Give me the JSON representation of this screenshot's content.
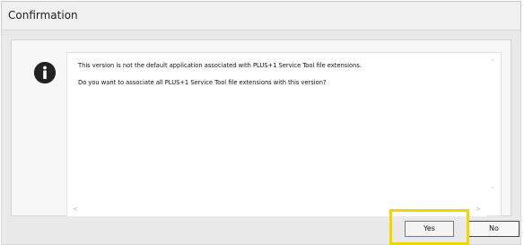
{
  "window": {
    "title": "Confirmation"
  },
  "message": {
    "line1": "This version is not the default application associated with PLUS+1 Service Tool file extensions.",
    "line2": "Do you want to associate all PLUS+1 Service Tool file extensions with this version?"
  },
  "icons": {
    "info": "info-icon",
    "scroll_up": "scroll-up-icon",
    "scroll_down": "scroll-down-icon",
    "scroll_left": "scroll-left-icon",
    "scroll_right": "scroll-right-icon"
  },
  "buttons": {
    "yes_label": "Yes",
    "no_label": "No"
  },
  "colors": {
    "highlight": "#f2d600",
    "icon": "#222222"
  }
}
